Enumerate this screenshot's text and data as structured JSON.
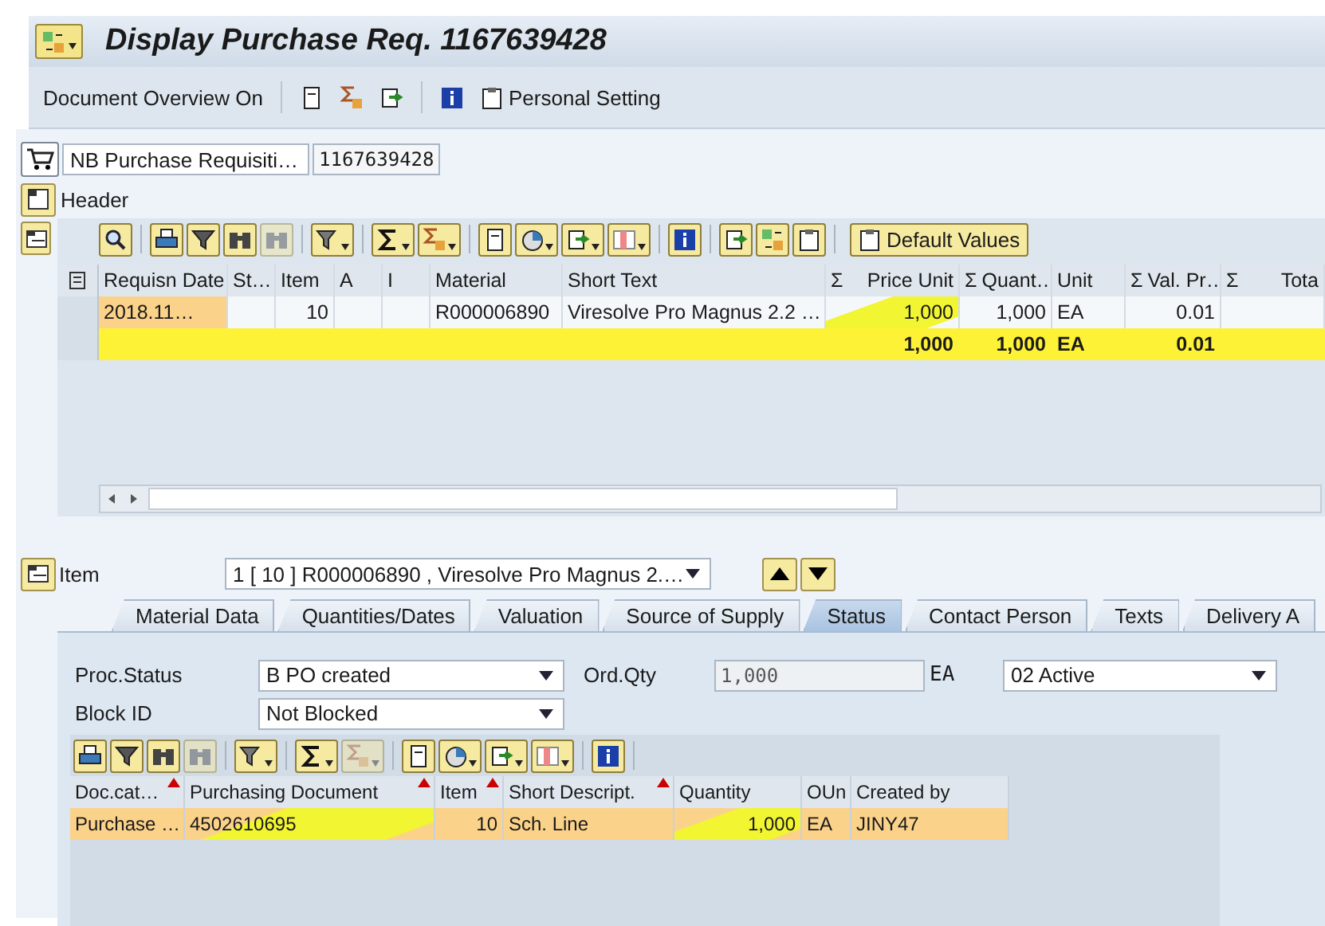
{
  "window": {
    "title": "Display Purchase Req. 1167639428"
  },
  "toolbar": {
    "overview_button": "Document Overview On",
    "personal_setting": "Personal Setting"
  },
  "document": {
    "type": "NB Purchase Requisiti…",
    "number": "1167639428"
  },
  "header": {
    "label": "Header",
    "expanded": false
  },
  "grid": {
    "toolbar": [
      {
        "dropdown": false,
        "disabled": false
      },
      {
        "dropdown": false,
        "disabled": false
      },
      {
        "dropdown": false,
        "disabled": false
      },
      {
        "dropdown": false,
        "disabled": false
      },
      {
        "dropdown": false,
        "disabled": true
      },
      {
        "dropdown": true,
        "disabled": false
      },
      {
        "dropdown": true,
        "disabled": false
      },
      {
        "dropdown": true,
        "disabled": false
      },
      {
        "dropdown": false,
        "disabled": false
      },
      {
        "dropdown": true,
        "disabled": false
      },
      {
        "dropdown": true,
        "disabled": false
      },
      {
        "dropdown": true,
        "disabled": false
      },
      {
        "dropdown": false,
        "disabled": false
      },
      {
        "dropdown": false,
        "disabled": false
      },
      {
        "dropdown": false,
        "disabled": false
      },
      {
        "dropdown": false,
        "disabled": false
      }
    ],
    "default_values": "Default Values",
    "columns": [
      {
        "label": "Requisn Date",
        "value": "2018.11…",
        "selected": true,
        "marked": false
      },
      {
        "label": "St…",
        "selected": false,
        "marked": false
      },
      {
        "label": "Item",
        "value": "10",
        "selected": false,
        "marked": false
      },
      {
        "label": "A",
        "selected": false,
        "marked": false
      },
      {
        "label": "I",
        "selected": false,
        "marked": false
      },
      {
        "label": "Material",
        "value": "R000006890",
        "selected": false,
        "marked": false
      },
      {
        "label": "Short Text",
        "value": "Viresolve Pro Magnus 2.2 …",
        "selected": false,
        "marked": false
      },
      {
        "mark": "Σ",
        "label": "Price Unit",
        "value": "1,000",
        "total": "1,000",
        "selected": false,
        "marked": true
      },
      {
        "mark": "Σ",
        "label": "Quant…",
        "value": "1,000",
        "total": "1,000",
        "selected": false,
        "marked": false
      },
      {
        "label": "Unit",
        "value": "EA",
        "total": "EA",
        "selected": false,
        "marked": false
      },
      {
        "mark": "Σ",
        "label": "Val. Pr…",
        "value": "0.01",
        "total": "0.01",
        "selected": false,
        "marked": false
      },
      {
        "mark": "Σ",
        "label": "Tota",
        "selected": false,
        "marked": false
      }
    ]
  },
  "item": {
    "label": "Item",
    "value": "1 [ 10 ] R000006890 , Viresolve Pro Magnus 2.…"
  },
  "tabs": [
    {
      "label": "Material Data",
      "selected": false
    },
    {
      "label": "Quantities/Dates",
      "selected": false
    },
    {
      "label": "Valuation",
      "selected": false
    },
    {
      "label": "Source of Supply",
      "selected": false
    },
    {
      "label": "Status",
      "selected": true
    },
    {
      "label": "Contact Person",
      "selected": false
    },
    {
      "label": "Texts",
      "selected": false
    },
    {
      "label": "Delivery A",
      "selected": false
    }
  ],
  "status": {
    "proc_status_label": "Proc.Status",
    "proc_status": "B PO created",
    "ord_qty_label": "Ord.Qty",
    "ord_qty": "1,000",
    "ord_unit": "EA",
    "active": "02 Active",
    "block_label": "Block ID",
    "block": "Not Blocked"
  },
  "po_grid": {
    "toolbar": [
      {
        "dropdown": false,
        "disabled": false
      },
      {
        "dropdown": false,
        "disabled": false
      },
      {
        "dropdown": false,
        "disabled": false
      },
      {
        "dropdown": false,
        "disabled": true
      },
      {
        "dropdown": true,
        "disabled": false
      },
      {
        "dropdown": true,
        "disabled": false
      },
      {
        "dropdown": true,
        "disabled": true
      },
      {
        "dropdown": false,
        "disabled": false
      },
      {
        "dropdown": true,
        "disabled": false
      },
      {
        "dropdown": true,
        "disabled": false
      },
      {
        "dropdown": true,
        "disabled": false
      },
      {
        "dropdown": false,
        "disabled": false
      }
    ],
    "row_selected": true,
    "columns": [
      {
        "label": "Doc.cat…",
        "sorted": true,
        "value": "Purchase …",
        "marked": false
      },
      {
        "label": "Purchasing Document",
        "sorted": true,
        "value": "4502610695",
        "marked": true
      },
      {
        "label": "Item",
        "sorted": true,
        "value": "10",
        "marked": false
      },
      {
        "label": "Short Descript.",
        "sorted": true,
        "value": "Sch. Line",
        "marked": false
      },
      {
        "label": "Quantity",
        "sorted": false,
        "value": "1,000",
        "marked": true
      },
      {
        "label": "OUn",
        "sorted": false,
        "value": "EA",
        "marked": false
      },
      {
        "label": "Created by",
        "sorted": false,
        "value": "JINY47",
        "marked": false
      }
    ]
  }
}
